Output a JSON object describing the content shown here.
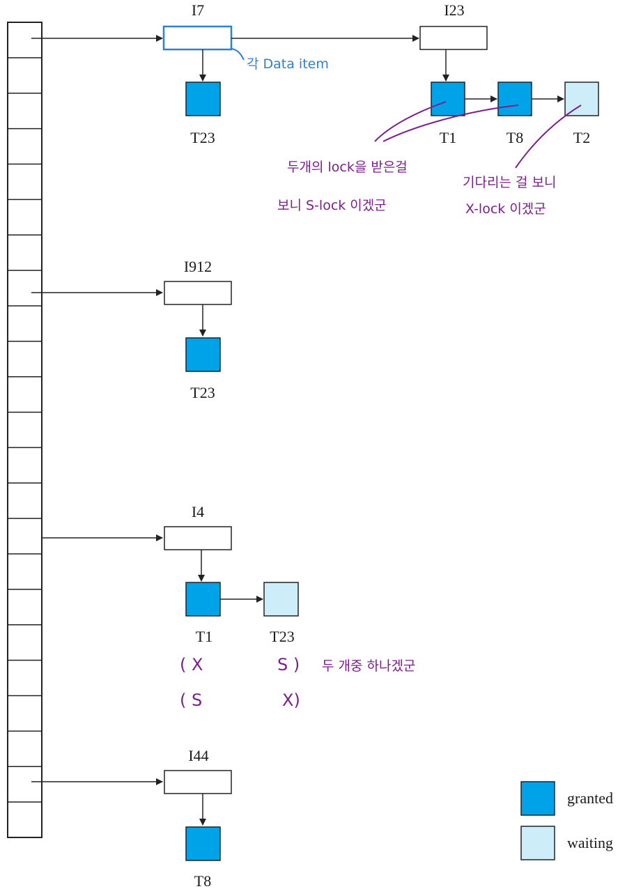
{
  "colors": {
    "granted": "#00a3e8",
    "waiting": "#cdeef9",
    "line": "#222222",
    "annotation_purple": "#7b1f8c",
    "annotation_blue": "#2f7fd6"
  },
  "items": {
    "i7": "I7",
    "i23": "I23",
    "i912": "I912",
    "i4": "I4",
    "i44": "I44"
  },
  "transactions": {
    "i7_t23": "T23",
    "i23_t1": "T1",
    "i23_t8": "T8",
    "i23_t2": "T2",
    "i912_t23": "T23",
    "i4_t1": "T1",
    "i4_t23": "T23",
    "i44_t8": "T8"
  },
  "legend": {
    "granted": "granted",
    "waiting": "waiting"
  },
  "annotations": {
    "data_item": "각 Data item",
    "two_locks_line1": "두개의 lock을 받은걸",
    "two_locks_line2": "보니 S-lock 이겠군",
    "waiting_line1": "기다리는 걸 보니",
    "waiting_line2": "X-lock 이겠군",
    "combo_row1_left": "( X",
    "combo_row1_right": "S )",
    "combo_note": "두 개중 하나겠군",
    "combo_row2_left": "( S",
    "combo_row2_right": "X)"
  }
}
